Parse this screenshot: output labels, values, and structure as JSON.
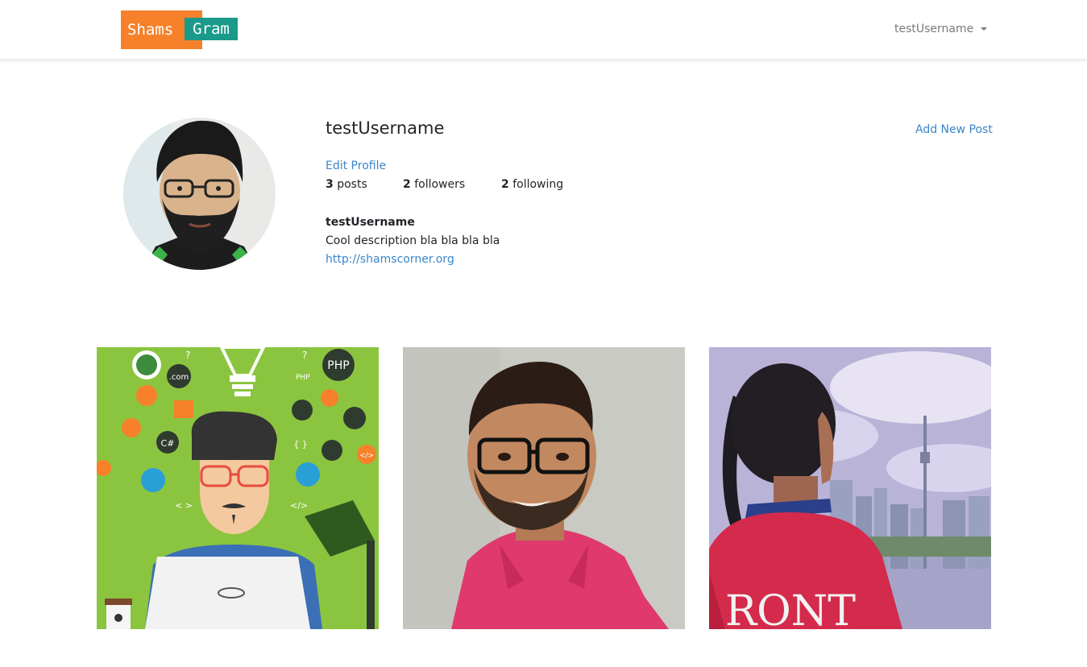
{
  "brand": {
    "part1": "Shams",
    "part2": "Gram"
  },
  "nav": {
    "username": "testUsername"
  },
  "profile": {
    "username": "testUsername",
    "edit_label": "Edit Profile",
    "add_post_label": "Add New Post",
    "stats": {
      "posts_count": "3",
      "posts_label": "posts",
      "followers_count": "2",
      "followers_label": "followers",
      "following_count": "2",
      "following_label": "following"
    },
    "bio": {
      "title": "testUsername",
      "description": "Cool description bla bla bla bla",
      "url": "http://shamscorner.org"
    }
  },
  "posts": [
    {
      "name": "developer-illustration"
    },
    {
      "name": "selfie-pink-shirt"
    },
    {
      "name": "toronto-skyline-braids"
    }
  ],
  "illustration_text": {
    "php": "PHP",
    "com": ".com",
    "csharp": "C#",
    "braces": "{ }",
    "code": "</>",
    "arrows": "< >",
    "slash_code": "</>",
    "php_small": "PHP",
    "q1": "?",
    "q2": "?",
    "toronto": "RONT"
  },
  "colors": {
    "brand_orange": "#f6812a",
    "brand_teal": "#1a9a8a",
    "link": "#3a86c8"
  }
}
